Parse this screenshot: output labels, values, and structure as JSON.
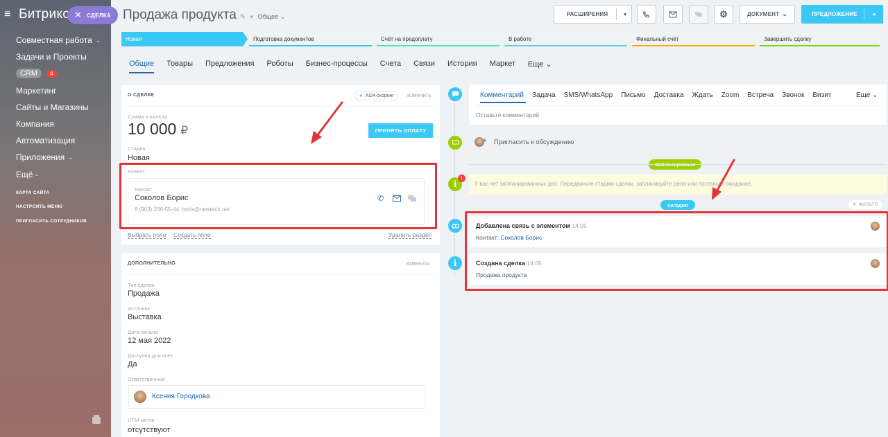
{
  "sidebar": {
    "brand": "Битрикс",
    "deal_pill": "СДЕЛКА",
    "items": [
      {
        "label": "Совместная работа",
        "chev": true
      },
      {
        "label": "Задачи и Проекты",
        "chev": false
      },
      {
        "label": "CRM",
        "badge": "4"
      },
      {
        "label": "Маркетинг",
        "chev": false
      },
      {
        "label": "Сайты и Магазины",
        "chev": false
      },
      {
        "label": "Компания",
        "chev": false
      },
      {
        "label": "Автоматизация",
        "chev": false
      },
      {
        "label": "Приложения",
        "chev": true
      },
      {
        "label": "Ещё -",
        "chev": false
      }
    ],
    "small": [
      "КАРТА САЙТА",
      "НАСТРОИТЬ МЕНЮ",
      "ПРИГЛАСИТЬ СОТРУДНИКОВ"
    ]
  },
  "header": {
    "title": "Продажа продукта",
    "category": "Общее",
    "btn_extensions": "РАСШИРЕНИЯ",
    "btn_document": "ДОКУМЕНТ",
    "btn_offer": "ПРЕДЛОЖЕНИЕ"
  },
  "stages": [
    {
      "label": "Новая",
      "color": "#3bc8f5"
    },
    {
      "label": "Подготовка документов",
      "color": "#2fc6f6"
    },
    {
      "label": "Счёт на предоплату",
      "color": "#47e4c2"
    },
    {
      "label": "В работе",
      "color": "#55d0e0"
    },
    {
      "label": "Финальный счёт",
      "color": "#ffa900"
    },
    {
      "label": "Завершить сделку",
      "color": "#7bd500"
    }
  ],
  "tabs": [
    "Общие",
    "Товары",
    "Предложения",
    "Роботы",
    "Бизнес-процессы",
    "Счета",
    "Связи",
    "История",
    "Маркет",
    "Еще"
  ],
  "about": {
    "heading": "О СДЕЛКЕ",
    "ai_chip": "AI24-скоринг",
    "edit": "изменить",
    "sum_label": "Сумма и валюта",
    "sum_value": "10 000",
    "currency": "₽",
    "pay_button": "ПРИНЯТЬ ОПЛАТУ",
    "stage_label": "Стадия",
    "stage_value": "Новая",
    "client_label": "Клиент",
    "contact_label": "Контакт",
    "contact_name": "Соколов Борис",
    "contact_info": "8 (903) 236-55-44, boris@newtech.net",
    "select_field": "Выбрать поле",
    "create_field": "Создать поле",
    "delete_section": "Удалить раздел"
  },
  "extra": {
    "heading": "ДОПОЛНИТЕЛЬНО",
    "edit": "изменить",
    "fields": [
      {
        "label": "Тип сделки",
        "value": "Продажа"
      },
      {
        "label": "Источник",
        "value": "Выставка"
      },
      {
        "label": "Дата начала",
        "value": "12 мая 2022"
      },
      {
        "label": "Доступна для всех",
        "value": "Да"
      }
    ],
    "responsible_label": "Ответственный",
    "responsible_name": "Ксения Городкова",
    "utm_label": "UTM-метки",
    "utm_value": "отсутствуют"
  },
  "timeline": {
    "editor_tabs": [
      "Комментарий",
      "Задача",
      "SMS/WhatsApp",
      "Письмо",
      "Доставка",
      "Ждать",
      "Zoom",
      "Встреча",
      "Звонок",
      "Визит"
    ],
    "editor_more": "Еще",
    "comment_placeholder": "Оставьте комментарий",
    "invite": "Пригласить к обсуждению",
    "planned": "Запланировано",
    "planned_badge": "1",
    "planned_notice": "У вас нет запланированных дел. Передвиньте стадию сделки, запланируйте дело или поставьте ожидание.",
    "today": "сегодня",
    "filter": "ФИЛЬТР",
    "event1_title": "Добавлена связь с элементом",
    "event1_time": "14:05",
    "event1_prefix": "Контакт:",
    "event1_link": "Соколов Борис",
    "event2_title": "Создана сделка",
    "event2_time": "14:05",
    "event2_text": "Продажа продукта"
  },
  "colors": {
    "accent": "#3bc8f5",
    "link": "#2067b0",
    "highlight": "#e0353a",
    "green": "#9dcf00"
  }
}
